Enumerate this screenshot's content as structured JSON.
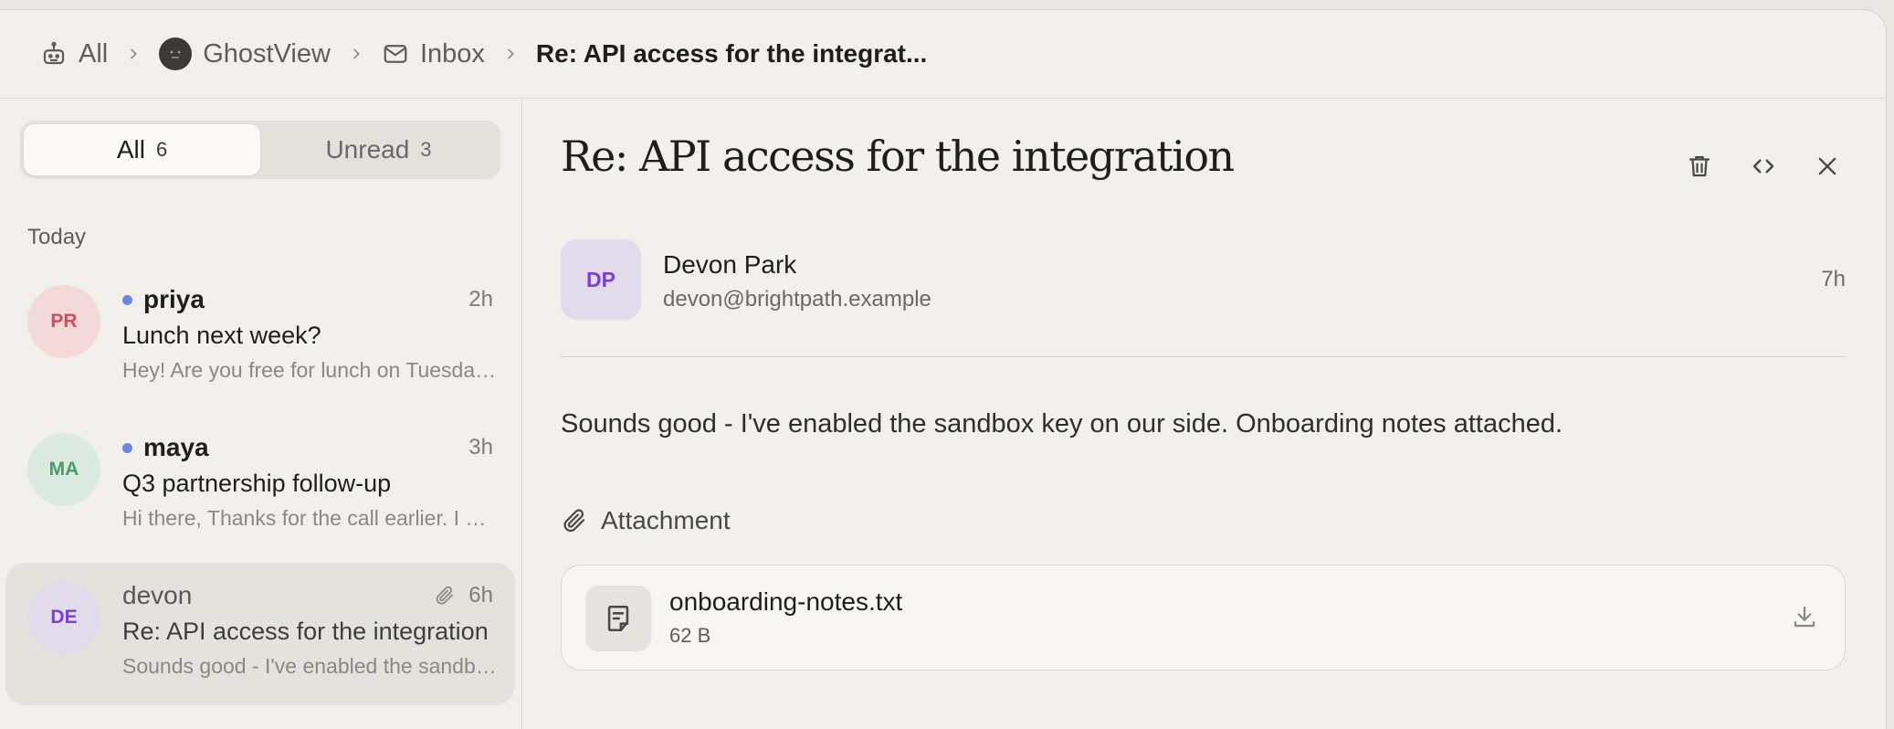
{
  "breadcrumb": {
    "all_label": "All",
    "account_label": "GhostView",
    "folder_label": "Inbox",
    "current_label": "Re: API access for the integrat..."
  },
  "filter": {
    "all_label": "All",
    "all_count": "6",
    "unread_label": "Unread",
    "unread_count": "3"
  },
  "list": {
    "section_label": "Today",
    "messages": [
      {
        "initials": "PR",
        "sender": "priya",
        "time": "2h",
        "subject": "Lunch next week?",
        "preview": "Hey! Are you free for lunch on Tuesday?",
        "unread": true,
        "avatar_bg": "#f4d9d9",
        "avatar_fg": "#d64a5e"
      },
      {
        "initials": "MA",
        "sender": "maya",
        "time": "3h",
        "subject": "Q3 partnership follow-up",
        "preview": "Hi there, Thanks for the call earlier. I wanted to follow up",
        "unread": true,
        "avatar_bg": "#dcebe1",
        "avatar_fg": "#4a9a6a"
      },
      {
        "initials": "DE",
        "sender": "devon",
        "time": "6h",
        "subject": "Re: API access for the integration",
        "preview": "Sounds good - I've enabled the sandbox key on our side.",
        "unread": false,
        "has_attachment": true,
        "avatar_bg": "#e2dbec",
        "avatar_fg": "#7a3fd3"
      }
    ]
  },
  "reader": {
    "title": "Re: API access for the integration",
    "from_initials": "DP",
    "from_name": "Devon Park",
    "from_email": "devon@brightpath.example",
    "time": "7h",
    "body": "Sounds good - I've enabled the sandbox key on our side. Onboarding notes attached.",
    "attachment_heading": "Attachment",
    "attachment": {
      "name": "onboarding-notes.txt",
      "size": "62 B"
    }
  },
  "colors": {
    "unread_dot": "#6b87d6",
    "background": "#f2f0ec"
  }
}
